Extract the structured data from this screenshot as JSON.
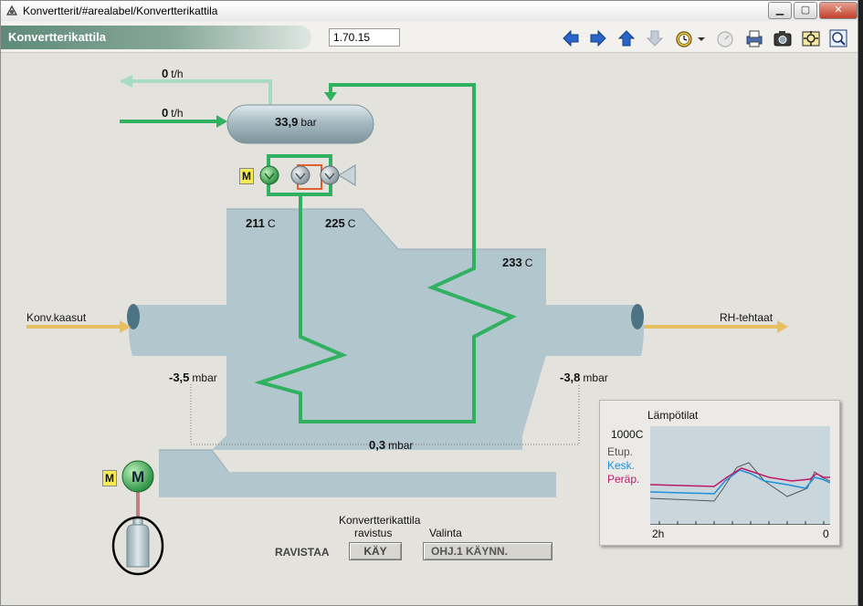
{
  "window": {
    "title": "Konvertterit/#arealabel/Konvertterikattila",
    "minimize_icon": "minimize-icon",
    "maximize_icon": "maximize-icon",
    "close_icon": "close-icon"
  },
  "toolbar": {
    "pane_title": "Konvertterikattila",
    "version": "1.70.15",
    "icons": [
      "back-arrow-icon",
      "forward-arrow-icon",
      "up-arrow-icon",
      "down-arrow-icon",
      "clock-icon",
      "dropdown-arrow-icon",
      "stopwatch-icon",
      "print-icon",
      "camera-icon",
      "settings-icon",
      "zoom-icon"
    ]
  },
  "process": {
    "steam_out": {
      "value": "0",
      "unit": "t/h"
    },
    "water_in": {
      "value": "0",
      "unit": "t/h"
    },
    "drum_pressure": {
      "value": "33,9",
      "unit": "bar"
    },
    "temp_1": {
      "value": "211",
      "unit": "C"
    },
    "temp_2": {
      "value": "225",
      "unit": "C"
    },
    "temp_3": {
      "value": "233",
      "unit": "C"
    },
    "inlet_label": "Konv.kaasut",
    "outlet_label": "RH-tehtaat",
    "press_left": {
      "value": "-3,5",
      "unit": "mbar"
    },
    "press_right": {
      "value": "-3,8",
      "unit": "mbar"
    },
    "press_diff": {
      "value": "0,3",
      "unit": "mbar"
    },
    "manual_tag": "M",
    "motor_tag": "M"
  },
  "rapping": {
    "title_line1": "Konvertterikattila",
    "title_line2": "ravistus",
    "valinta_label": "Valinta",
    "ravistaa_label": "RAVISTAA",
    "kay_button": "KÄY",
    "selection_value": "OHJ.1 KÄYNN."
  },
  "trend": {
    "title": "Lämpötilat",
    "ymax": "1000C",
    "legend": [
      {
        "name": "Etup.",
        "color": "#555555"
      },
      {
        "name": "Kesk.",
        "color": "#1e8fd8"
      },
      {
        "name": "Peräp.",
        "color": "#c0186a"
      }
    ],
    "x_start": "2h",
    "x_end": "0"
  },
  "colors": {
    "pipe_green": "#2fb15f",
    "steam_light": "#a8dcc0",
    "gas_yellow": "#e6c060",
    "vessel": "#b2c6ce",
    "valve_orange": "#e06030"
  }
}
